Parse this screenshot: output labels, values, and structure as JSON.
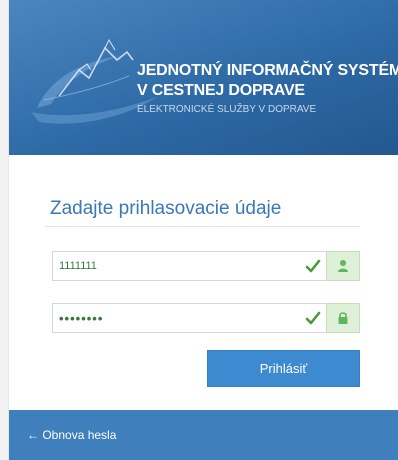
{
  "header": {
    "title_line1": "JEDNOTNÝ INFORMAČNÝ SYSTÉM",
    "title_line2": "V CESTNEJ DOPRAVE",
    "subtitle": "ELEKTRONICKÉ SLUŽBY V DOPRAVE"
  },
  "login": {
    "heading": "Zadajte prihlasovacie údaje",
    "username": {
      "value": "1111111",
      "valid_icon": "check-icon",
      "addon_icon": "user-icon"
    },
    "password": {
      "value": "••••••••",
      "valid_icon": "check-icon",
      "addon_icon": "lock-icon"
    },
    "submit_label": "Prihlásiť"
  },
  "footer": {
    "reset_icon": "arrow-left-icon",
    "reset_label": "Obnova hesla"
  },
  "colors": {
    "header_blue": "#2e6aa6",
    "heading_blue": "#3a78b6",
    "button_blue": "#3d8ad0",
    "footer_blue": "#3f7fbc",
    "success_green": "#5cb85c",
    "success_bg": "#dff0d8"
  }
}
